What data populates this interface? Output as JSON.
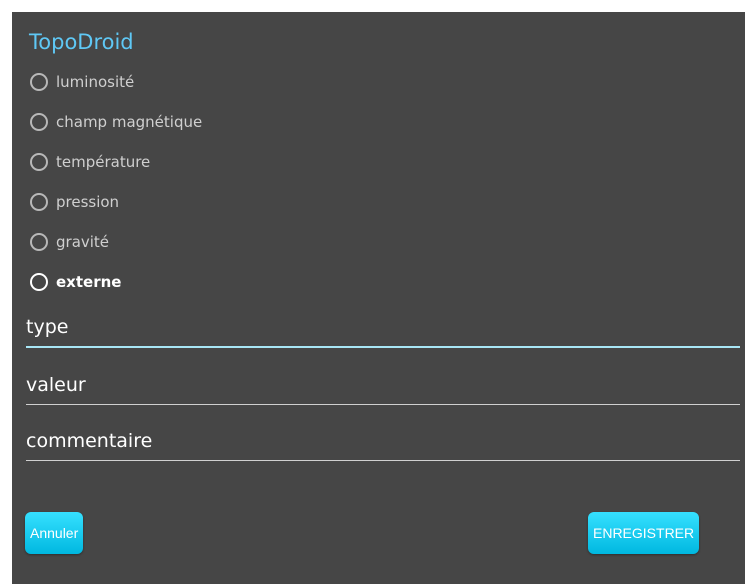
{
  "dialog": {
    "title": "TopoDroid"
  },
  "sensors": [
    {
      "label": "luminosité",
      "selected": false
    },
    {
      "label": "champ magnétique",
      "selected": false
    },
    {
      "label": "température",
      "selected": false
    },
    {
      "label": "pression",
      "selected": false
    },
    {
      "label": "gravité",
      "selected": false
    },
    {
      "label": "externe",
      "selected": true
    }
  ],
  "fields": {
    "type": {
      "placeholder": "type",
      "value": ""
    },
    "value": {
      "placeholder": "valeur",
      "value": ""
    },
    "comment": {
      "placeholder": "commentaire",
      "value": ""
    }
  },
  "buttons": {
    "cancel_label": "Annuler",
    "save_label": "ENREGISTRER"
  },
  "colors": {
    "background": "#464646",
    "title": "#5fc8f5",
    "button": "#1ccff5",
    "focus_underline": "#a8e6f5"
  }
}
